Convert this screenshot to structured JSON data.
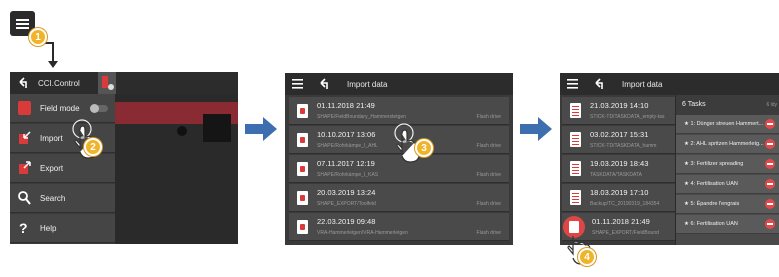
{
  "steps": [
    "1",
    "2",
    "3",
    "4"
  ],
  "panel1": {
    "title": "CCI.Control",
    "items": [
      {
        "label": "Field mode",
        "icon": "field-mode-icon"
      },
      {
        "label": "Import",
        "icon": "import-icon"
      },
      {
        "label": "Export",
        "icon": "export-icon"
      },
      {
        "label": "Search",
        "icon": "search-icon"
      },
      {
        "label": "Help",
        "icon": "help-icon"
      }
    ]
  },
  "panel2": {
    "title": "Import data",
    "rows": [
      {
        "date": "01.11.2018 21:49",
        "path": "SHAPE/FieldBoundary_Hammerstetgen",
        "source": "Flash drive"
      },
      {
        "date": "10.10.2017 13:06",
        "path": "SHAPE/Rohrkämpe_I_AHL",
        "source": "Flash drive"
      },
      {
        "date": "07.11.2017 12:19",
        "path": "SHAPE/Rohrkämpe_I_KAS",
        "source": "Flash drive"
      },
      {
        "date": "20.03.2019 13:24",
        "path": "SHAPE_EXPORT/Toolfeld",
        "source": "Flash drive"
      },
      {
        "date": "22.03.2019 09:48",
        "path": "VRA-Hammerletgen/VRA-Hammerletgen",
        "source": "Flash drive"
      }
    ]
  },
  "panel3": {
    "title": "Import data",
    "rows": [
      {
        "date": "21.03.2019 14:10",
        "path": "STICK-TD/TASKDATA_empty-tas"
      },
      {
        "date": "03.02.2017 15:31",
        "path": "STICK-TD/TASKDATA_hamm"
      },
      {
        "date": "19.03.2019 18:43",
        "path": "TASKDATA/TASKDATA"
      },
      {
        "date": "18.03.2019 17:10",
        "path": "Backup/TC_20190319_184354"
      },
      {
        "date": "01.11.2018 21:49",
        "path": "SHAPE_EXPORT/FieldBound"
      }
    ],
    "tasks_header": "6 Tasks",
    "tasks_count": "6 ldy",
    "tasks": [
      "1: Dünger streuen Hammert...",
      "2: AHL spritzen Hammerletg...",
      "3: Fertilizer spreading",
      "4: Fertilisation UAN",
      "5: Épandre l'engrais",
      "6: Fertilisation UAN"
    ]
  },
  "colors": {
    "badge": "#f0b42a",
    "flow_arrow": "#3d6fb0",
    "accent_red": "#d93a3a",
    "panel_bg": "#3a3a3a"
  }
}
